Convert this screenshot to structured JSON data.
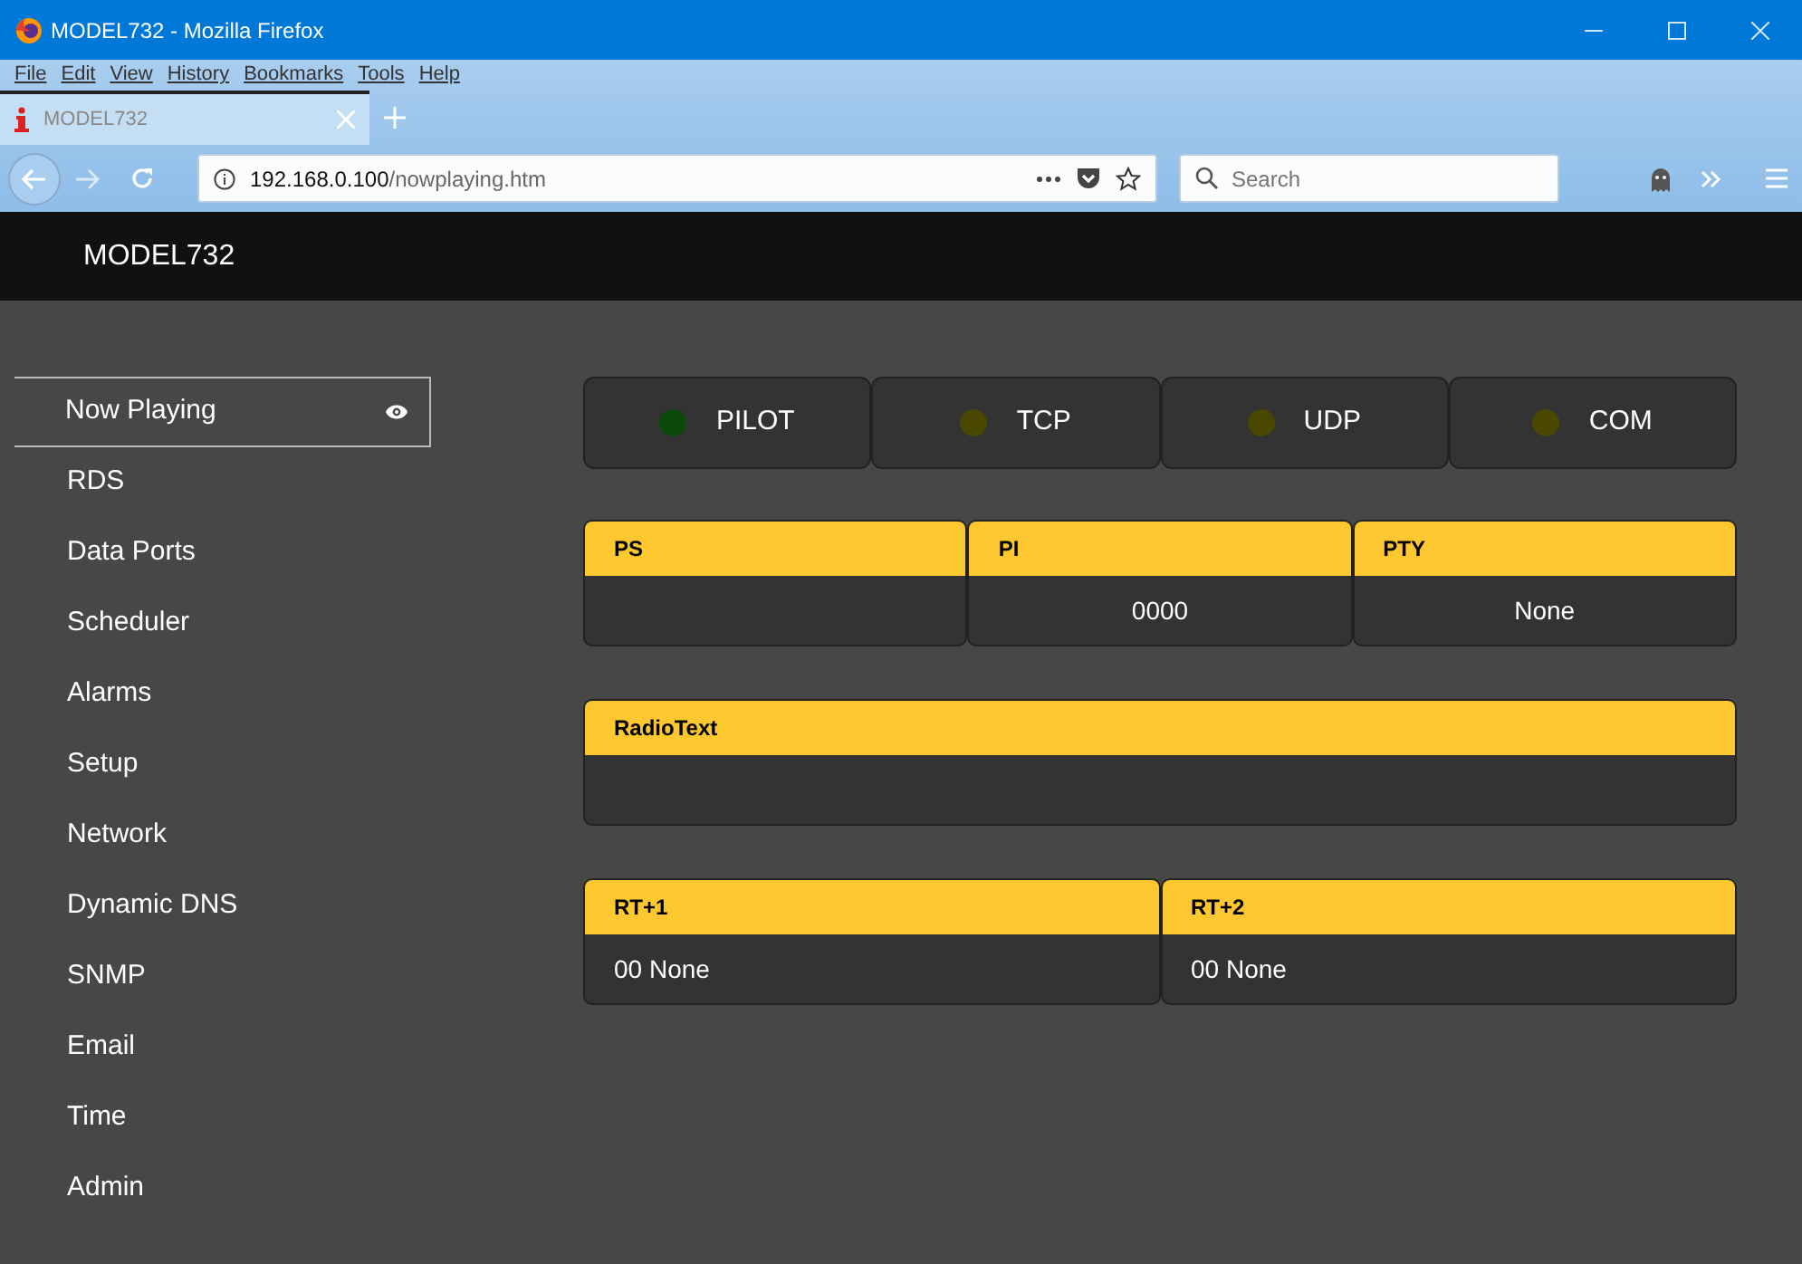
{
  "window": {
    "title": "MODEL732 - Mozilla Firefox"
  },
  "menu": [
    "File",
    "Edit",
    "View",
    "History",
    "Bookmarks",
    "Tools",
    "Help"
  ],
  "tabs": [
    {
      "label": "MODEL732",
      "selected": true
    }
  ],
  "address": {
    "host": "192.168.0.100",
    "path": "/nowplaying.htm"
  },
  "search": {
    "placeholder": "Search"
  },
  "page": {
    "brand": "MODEL732",
    "sidebar": [
      {
        "label": "Now Playing",
        "selected": true
      },
      {
        "label": "RDS",
        "selected": false
      },
      {
        "label": "Data Ports",
        "selected": false
      },
      {
        "label": "Scheduler",
        "selected": false
      },
      {
        "label": "Alarms",
        "selected": false
      },
      {
        "label": "Setup",
        "selected": false
      },
      {
        "label": "Network",
        "selected": false
      },
      {
        "label": "Dynamic DNS",
        "selected": false
      },
      {
        "label": "SNMP",
        "selected": false
      },
      {
        "label": "Email",
        "selected": false
      },
      {
        "label": "Time",
        "selected": false
      },
      {
        "label": "Admin",
        "selected": false
      }
    ],
    "indicators": [
      {
        "label": "PILOT",
        "color": "#0b4a0b"
      },
      {
        "label": "TCP",
        "color": "#4a4700"
      },
      {
        "label": "UDP",
        "color": "#4a4700"
      },
      {
        "label": "COM",
        "color": "#4a4700"
      }
    ],
    "panel_rows": [
      [
        {
          "title": "PS",
          "kind": "centered"
        },
        {
          "title": "PI",
          "value": "0000",
          "kind": "centered"
        },
        {
          "title": "PTY",
          "value": "None",
          "kind": "centered"
        }
      ],
      [
        {
          "title": "RadioText",
          "kind": "plain"
        }
      ],
      [
        {
          "title": "RT+1",
          "value": "00 None",
          "kind": "plain"
        },
        {
          "title": "RT+2",
          "value": "00 None",
          "kind": "plain"
        }
      ]
    ]
  }
}
